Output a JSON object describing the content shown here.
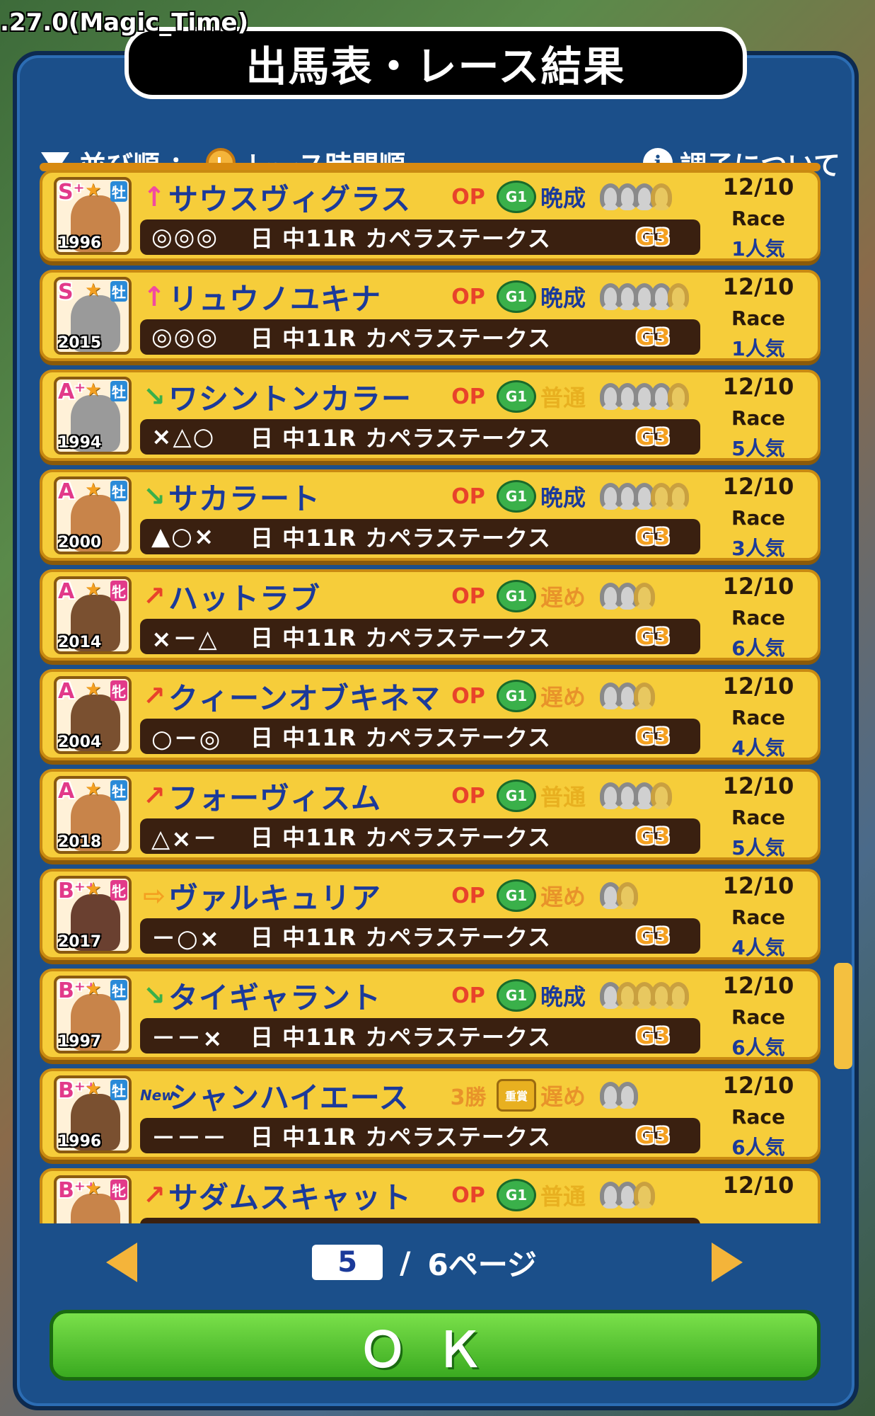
{
  "version": ".27.0(Magic_Time)",
  "title": "出馬表・レース結果",
  "toolbar": {
    "sort_label": "並び順 ：",
    "sort_value": "レース時間順",
    "info_label": "調子について"
  },
  "rows": [
    {
      "rank": "S⁺",
      "sex": "牡",
      "year": "1996",
      "arrow": "↑",
      "arrow_color": "#f24aa0",
      "name": "サウスヴィグラス",
      "class": "OP",
      "badge": "G1",
      "growth": "晩成",
      "growth_color": "#1b3a9a",
      "shoes_filled": 3,
      "shoes_total": 4,
      "marks": "◎◎◎",
      "race": "日 中11R カペラステークス",
      "grade": "G3",
      "date": "12/10",
      "race_label": "Race",
      "popularity": "1人気",
      "coat": "#c8844a"
    },
    {
      "rank": "S",
      "sex": "牡",
      "year": "2015",
      "arrow": "↑",
      "arrow_color": "#f24aa0",
      "name": "リュウノユキナ",
      "class": "OP",
      "badge": "G1",
      "growth": "晩成",
      "growth_color": "#1b3a9a",
      "shoes_filled": 4,
      "shoes_total": 5,
      "marks": "◎◎◎",
      "race": "日 中11R カペラステークス",
      "grade": "G3",
      "date": "12/10",
      "race_label": "Race",
      "popularity": "1人気",
      "coat": "#9a9a9a"
    },
    {
      "rank": "A⁺",
      "sex": "牡",
      "year": "1994",
      "arrow": "↘",
      "arrow_color": "#3ab04a",
      "name": "ワシントンカラー",
      "class": "OP",
      "badge": "G1",
      "growth": "普通",
      "growth_color": "#e8b020",
      "shoes_filled": 4,
      "shoes_total": 5,
      "marks": "×△○",
      "race": "日 中11R カペラステークス",
      "grade": "G3",
      "date": "12/10",
      "race_label": "Race",
      "popularity": "5人気",
      "coat": "#9a9a9a"
    },
    {
      "rank": "A",
      "sex": "牡",
      "year": "2000",
      "arrow": "↘",
      "arrow_color": "#3ab04a",
      "name": "サカラート",
      "class": "OP",
      "badge": "G1",
      "growth": "晩成",
      "growth_color": "#1b3a9a",
      "shoes_filled": 3,
      "shoes_total": 5,
      "marks": "▲○×",
      "race": "日 中11R カペラステークス",
      "grade": "G3",
      "date": "12/10",
      "race_label": "Race",
      "popularity": "3人気",
      "coat": "#c8844a"
    },
    {
      "rank": "A",
      "sex": "牝",
      "year": "2014",
      "arrow": "↗",
      "arrow_color": "#e8432a",
      "name": "ハットラブ",
      "class": "OP",
      "badge": "G1",
      "growth": "遅め",
      "growth_color": "#e8932a",
      "shoes_filled": 2,
      "shoes_total": 3,
      "marks": "×－△",
      "race": "日 中11R カペラステークス",
      "grade": "G3",
      "date": "12/10",
      "race_label": "Race",
      "popularity": "6人気",
      "coat": "#7a5030"
    },
    {
      "rank": "A",
      "sex": "牝",
      "year": "2004",
      "arrow": "↗",
      "arrow_color": "#e8432a",
      "name": "クィーンオブキネマ",
      "class": "OP",
      "badge": "G1",
      "growth": "遅め",
      "growth_color": "#e8932a",
      "shoes_filled": 2,
      "shoes_total": 3,
      "marks": "○－◎",
      "race": "日 中11R カペラステークス",
      "grade": "G3",
      "date": "12/10",
      "race_label": "Race",
      "popularity": "4人気",
      "coat": "#7a5030"
    },
    {
      "rank": "A",
      "sex": "牡",
      "year": "2018",
      "arrow": "↗",
      "arrow_color": "#e8432a",
      "name": "フォーヴィスム",
      "class": "OP",
      "badge": "G1",
      "growth": "普通",
      "growth_color": "#e8b020",
      "shoes_filled": 3,
      "shoes_total": 4,
      "marks": "△×－",
      "race": "日 中11R カペラステークス",
      "grade": "G3",
      "date": "12/10",
      "race_label": "Race",
      "popularity": "5人気",
      "coat": "#c8844a"
    },
    {
      "rank": "B⁺⁺",
      "sex": "牝",
      "year": "2017",
      "arrow": "⇨",
      "arrow_color": "#f4a020",
      "name": "ヴァルキュリア",
      "class": "OP",
      "badge": "G1",
      "growth": "遅め",
      "growth_color": "#e8932a",
      "shoes_filled": 1,
      "shoes_total": 2,
      "marks": "－○×",
      "race": "日 中11R カペラステークス",
      "grade": "G3",
      "date": "12/10",
      "race_label": "Race",
      "popularity": "4人気",
      "coat": "#6a4030"
    },
    {
      "rank": "B⁺⁺",
      "sex": "牡",
      "year": "1997",
      "arrow": "↘",
      "arrow_color": "#3ab04a",
      "name": "タイギャラント",
      "class": "OP",
      "badge": "G1",
      "growth": "晩成",
      "growth_color": "#1b3a9a",
      "shoes_filled": 1,
      "shoes_total": 5,
      "marks": "－－×",
      "race": "日 中11R カペラステークス",
      "grade": "G3",
      "date": "12/10",
      "race_label": "Race",
      "popularity": "6人気",
      "coat": "#c8844a"
    },
    {
      "rank": "B⁺⁺",
      "sex": "牡",
      "year": "1996",
      "arrow": "New",
      "arrow_color": "#1b3a9a",
      "name": "シャンハイエース",
      "class": "3勝",
      "badge": "重賞",
      "growth": "遅め",
      "growth_color": "#e8932a",
      "shoes_filled": 2,
      "shoes_total": 2,
      "marks": "－－－",
      "race": "日 中11R カペラステークス",
      "grade": "G3",
      "date": "12/10",
      "race_label": "Race",
      "popularity": "6人気",
      "coat": "#7a5030"
    },
    {
      "rank": "B⁺⁺",
      "sex": "牝",
      "year": "",
      "arrow": "↗",
      "arrow_color": "#e8432a",
      "name": "サダムスキャット",
      "class": "OP",
      "badge": "G1",
      "growth": "普通",
      "growth_color": "#e8b020",
      "shoes_filled": 2,
      "shoes_total": 3,
      "marks": "",
      "race": "",
      "grade": "",
      "date": "12/10",
      "race_label": "",
      "popularity": "",
      "coat": "#c8844a"
    }
  ],
  "pager": {
    "current": "5",
    "separator": "/",
    "total": "6ページ"
  },
  "ok_label": "ＯＫ"
}
